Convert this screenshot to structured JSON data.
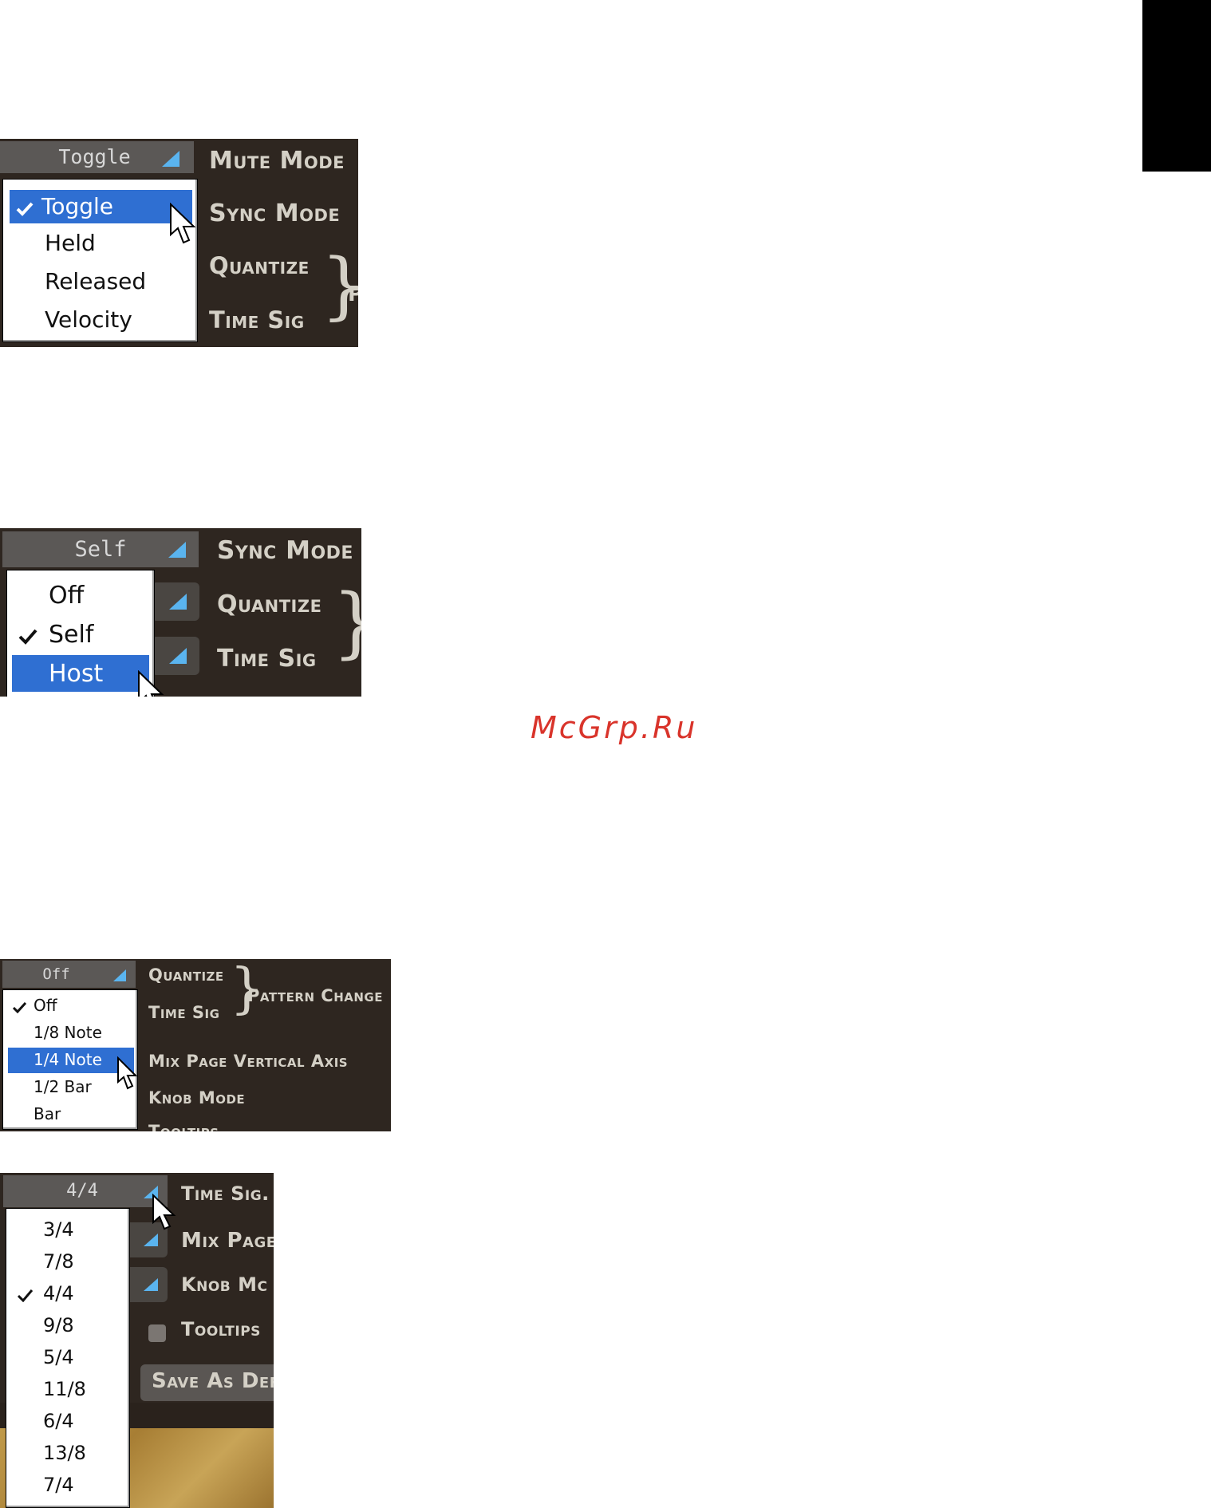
{
  "page": {
    "watermark": "McGrp.Ru"
  },
  "shot1": {
    "header_value": "Toggle",
    "labels": {
      "mute_mode": "Mute Mode",
      "sync_mode": "Sync Mode",
      "quantize": "Quantize",
      "time_sig": "Time Sig",
      "partial": "P"
    },
    "menu": [
      "Toggle",
      "Held",
      "Released",
      "Velocity"
    ],
    "checked": "Toggle",
    "highlighted": "Toggle"
  },
  "shot2": {
    "header_value": "Self",
    "labels": {
      "sync_mode": "Sync Mode",
      "quantize": "Quantize",
      "time_sig": "Time Sig"
    },
    "menu": [
      "Off",
      "Self",
      "Host"
    ],
    "checked": "Self",
    "highlighted": "Host"
  },
  "shot3": {
    "header_value": "Off",
    "labels": {
      "quantize": "Quantize",
      "time_sig": "Time Sig",
      "pattern_change": "Pattern Change",
      "mix_page": "Mix Page Vertical Axis",
      "knob_mode": "Knob Mode",
      "tooltips": "Tooltips"
    },
    "menu": [
      "Off",
      "1/8 Note",
      "1/4 Note",
      "1/2 Bar",
      "Bar"
    ],
    "checked": "Off",
    "highlighted": "1/4 Note"
  },
  "shot4": {
    "header_value": "4/4",
    "labels": {
      "time_sig": "Time Sig.",
      "mix_page": "Mix Page",
      "knob_mode": "Knob Mc",
      "tooltips": "Tooltips",
      "save_default": "Save As Defa"
    },
    "menu": [
      "3/4",
      "7/8",
      "4/4",
      "9/8",
      "5/4",
      "11/8",
      "6/4",
      "13/8",
      "7/4"
    ],
    "checked": "4/4",
    "highlighted": ""
  },
  "colors": {
    "panel_bg": "#2e2620",
    "header_bg": "#5b5856",
    "highlight": "#2f6fd2",
    "accent_triangle": "#5ab4ef",
    "watermark": "#d9342b"
  },
  "icons": {
    "check": "checkmark-icon",
    "cursor": "mouse-pointer-icon",
    "dropdown": "dropdown-triangle-icon"
  }
}
